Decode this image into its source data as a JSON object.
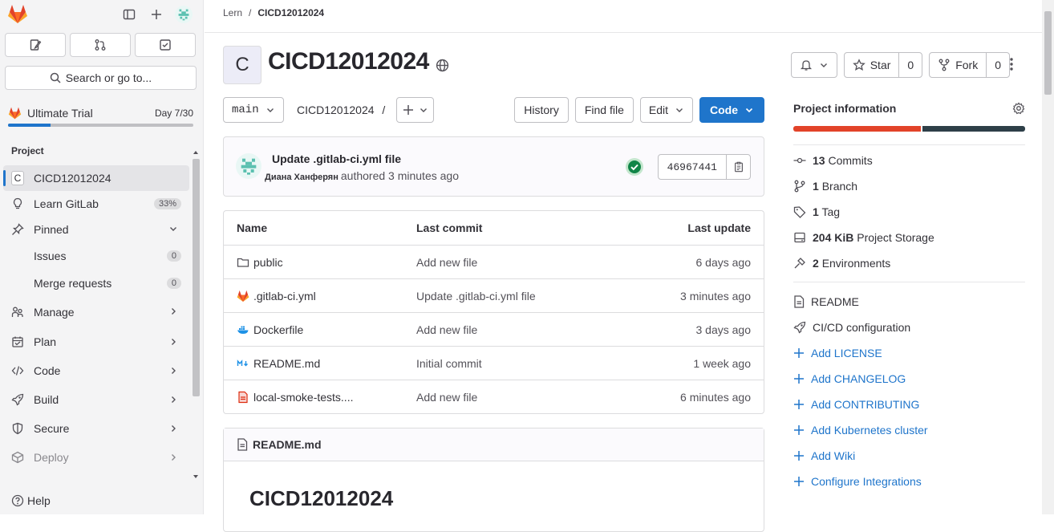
{
  "sidebar": {
    "search_label": "Search or go to...",
    "trial": {
      "label": "Ultimate Trial",
      "day": "Day 7/30",
      "progress": 0.23
    },
    "section_title": "Project",
    "project_item": {
      "avatar": "C",
      "label": "CICD12012024"
    },
    "learn": {
      "label": "Learn GitLab",
      "badge": "33%"
    },
    "pinned": {
      "label": "Pinned"
    },
    "issues": {
      "label": "Issues",
      "count": "0"
    },
    "merge_requests": {
      "label": "Merge requests",
      "count": "0"
    },
    "manage": "Manage",
    "plan": "Plan",
    "code": "Code",
    "build": "Build",
    "secure": "Secure",
    "deploy": "Deploy",
    "help": "Help"
  },
  "breadcrumb": {
    "parent": "Lern",
    "separator": "/",
    "current": "CICD12012024"
  },
  "project": {
    "avatar": "C",
    "title": "CICD12012024",
    "star_label": "Star",
    "star_count": "0",
    "fork_label": "Fork",
    "fork_count": "0"
  },
  "repo_bar": {
    "branch": "main",
    "path": "CICD12012024",
    "path_sep": "/",
    "history": "History",
    "find_file": "Find file",
    "edit": "Edit",
    "code": "Code"
  },
  "last_commit": {
    "message": "Update .gitlab-ci.yml file",
    "author": "Диана Ханферян",
    "authored": "authored 3 minutes ago",
    "sha": "46967441"
  },
  "file_table": {
    "headers": {
      "name": "Name",
      "commit": "Last commit",
      "update": "Last update"
    },
    "rows": [
      {
        "name": "public",
        "commit": "Add new file",
        "update": "6 days ago",
        "icon": "folder-icon"
      },
      {
        "name": ".gitlab-ci.yml",
        "commit": "Update .gitlab-ci.yml file",
        "update": "3 minutes ago",
        "icon": "gitlab-file-icon"
      },
      {
        "name": "Dockerfile",
        "commit": "Add new file",
        "update": "3 days ago",
        "icon": "docker-icon"
      },
      {
        "name": "README.md",
        "commit": "Initial commit",
        "update": "1 week ago",
        "icon": "markdown-icon"
      },
      {
        "name": "local-smoke-tests....",
        "commit": "Add new file",
        "update": "6 minutes ago",
        "icon": "pdf-file-icon"
      }
    ]
  },
  "readme": {
    "filename": "README.md",
    "heading": "CICD12012024"
  },
  "info": {
    "title": "Project information",
    "commits": {
      "num": "13",
      "label": "Commits"
    },
    "branch": {
      "num": "1",
      "label": "Branch"
    },
    "tag": {
      "num": "1",
      "label": "Tag"
    },
    "storage": {
      "num": "204 KiB",
      "label": "Project Storage"
    },
    "envs": {
      "num": "2",
      "label": "Environments"
    },
    "readme": "README",
    "cicd": "CI/CD configuration",
    "links": [
      "Add LICENSE",
      "Add CHANGELOG",
      "Add CONTRIBUTING",
      "Add Kubernetes cluster",
      "Add Wiki",
      "Configure Integrations"
    ],
    "language_split": [
      0.55,
      0.45
    ],
    "language_colors": [
      "#e24329",
      "#2e3f48"
    ]
  }
}
